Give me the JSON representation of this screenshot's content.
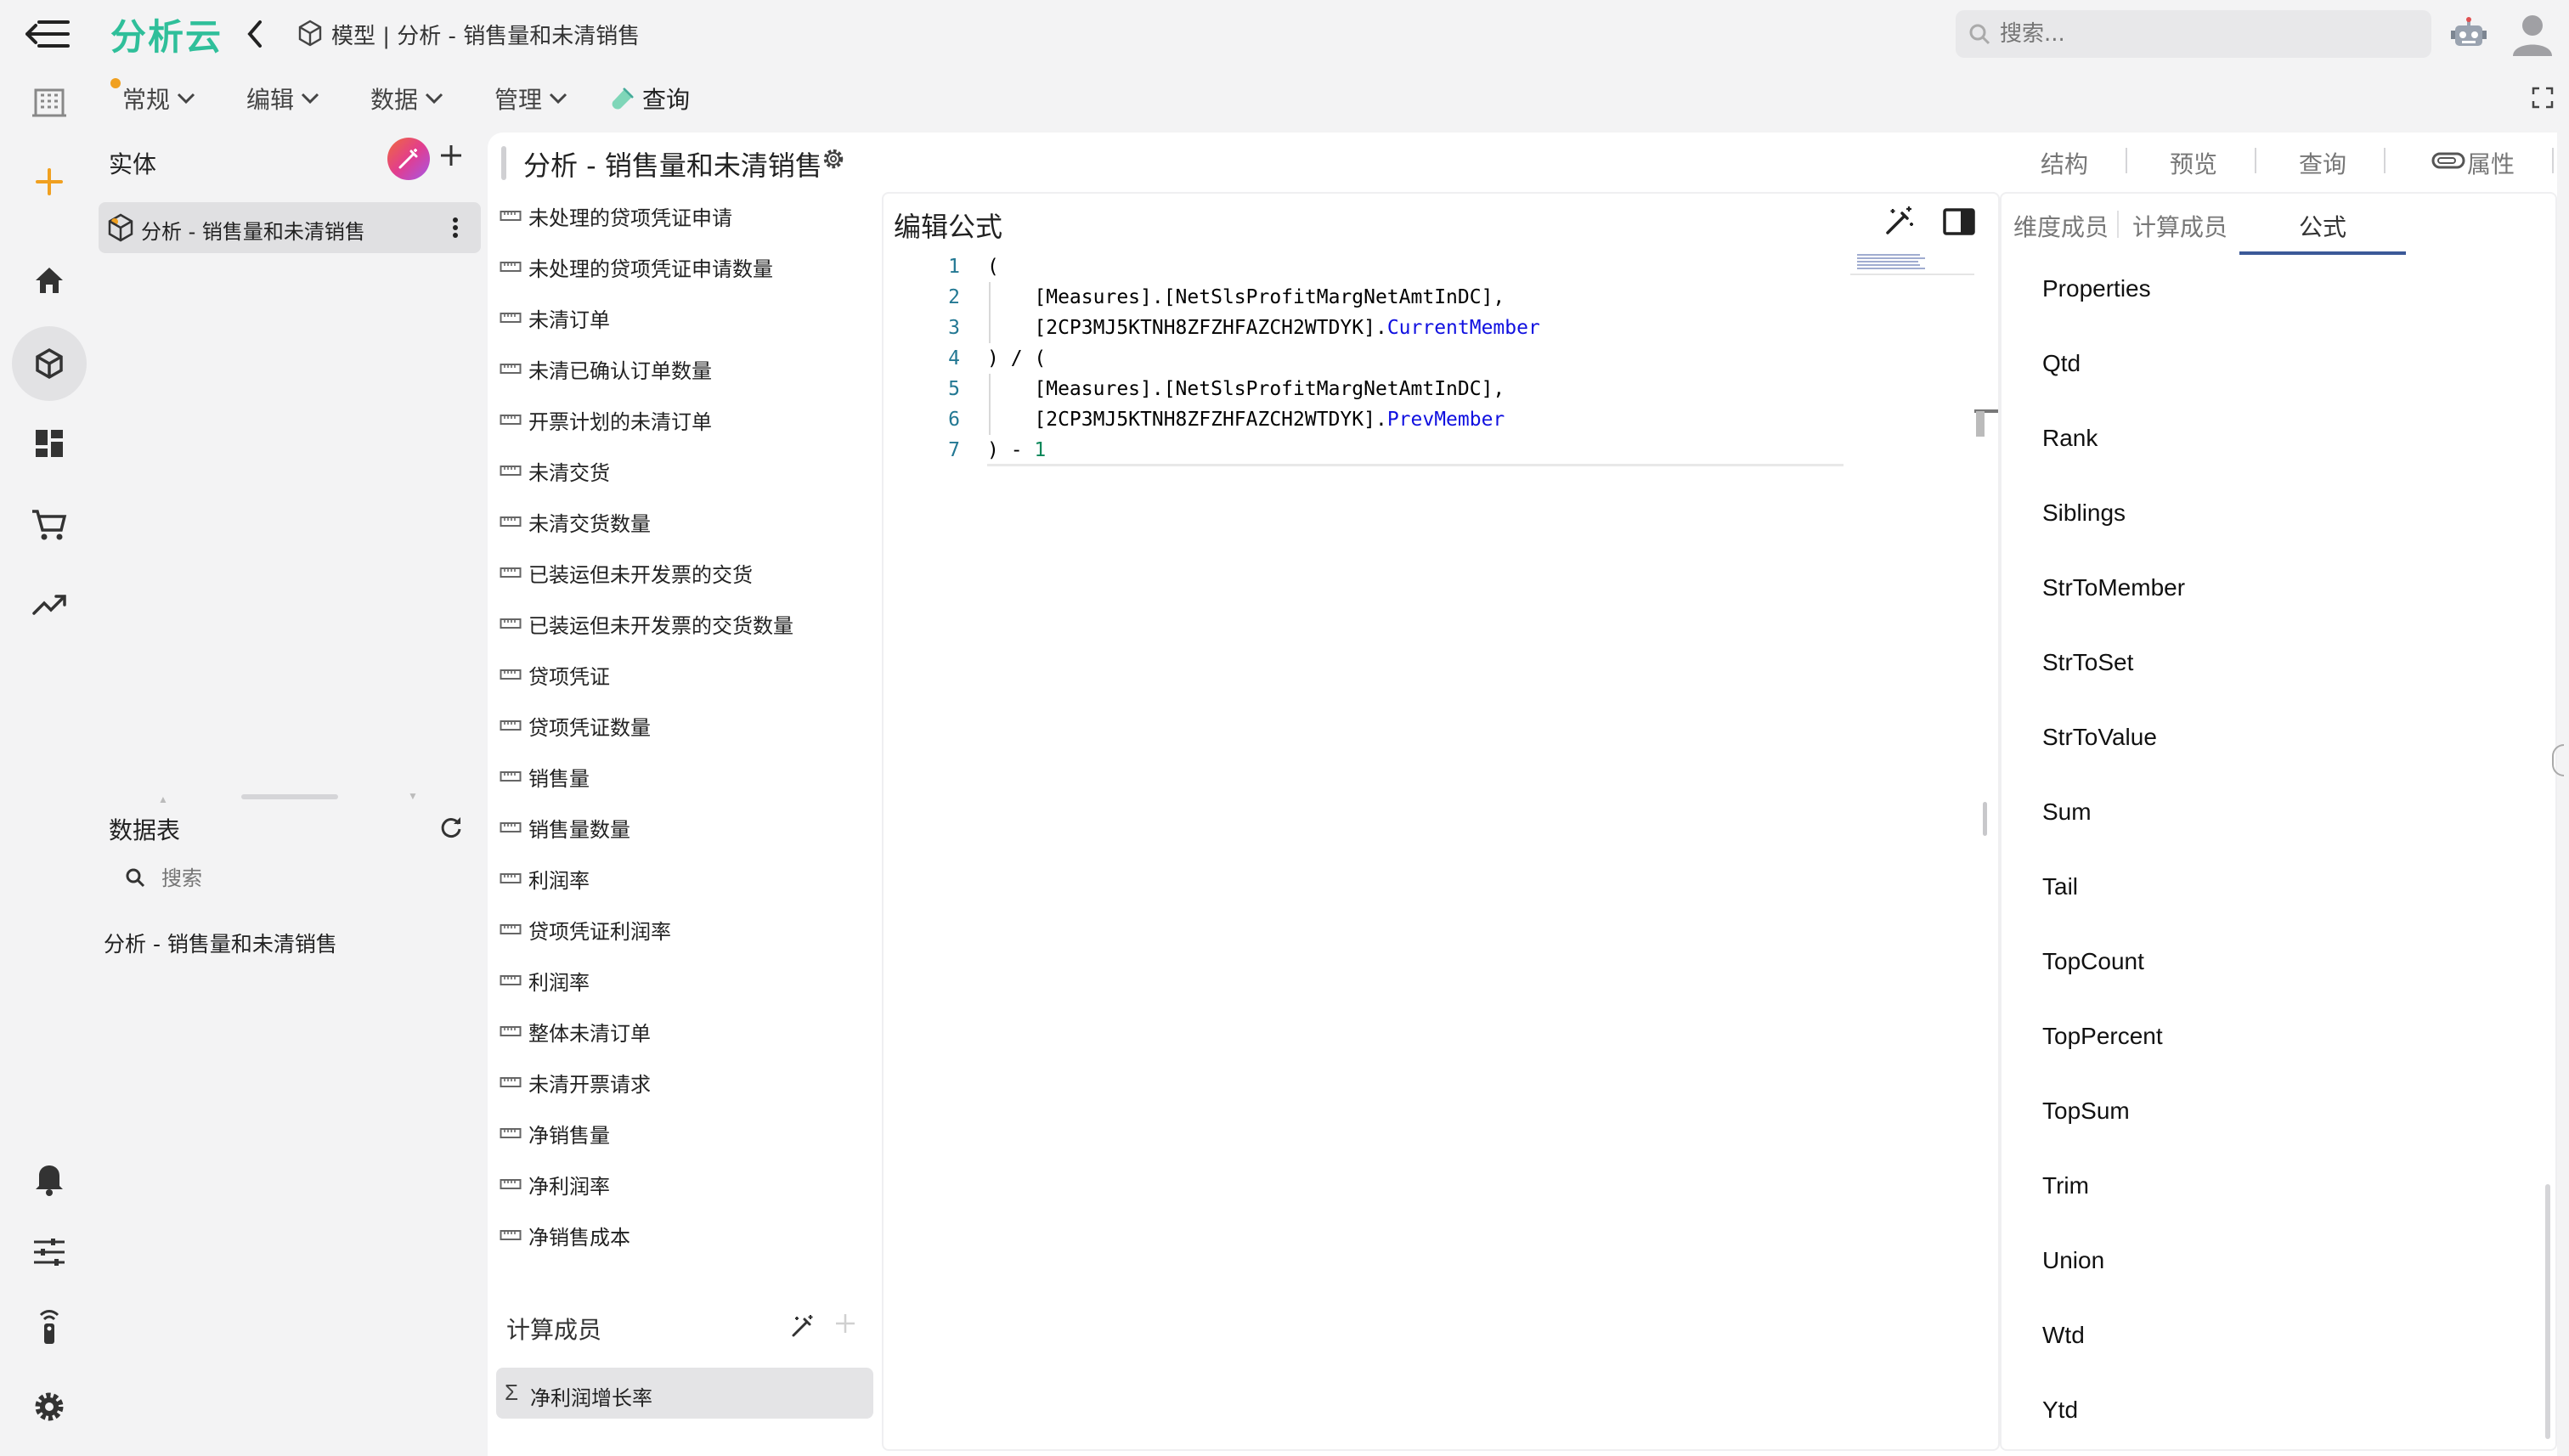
{
  "app": {
    "brand": "分析云",
    "breadcrumb": "模型 | 分析 - 销售量和未清销售"
  },
  "search": {
    "placeholder": "搜索..."
  },
  "menubar": {
    "items": [
      {
        "label": "常规"
      },
      {
        "label": "编辑"
      },
      {
        "label": "数据"
      },
      {
        "label": "管理"
      }
    ],
    "query_label": "查询"
  },
  "entity_panel": {
    "title": "实体",
    "items": [
      {
        "label": "分析 - 销售量和未清销售"
      }
    ]
  },
  "datasource_panel": {
    "title": "数据表",
    "search_placeholder": "搜索",
    "items": [
      {
        "label": "分析 - 销售量和未清销售"
      }
    ]
  },
  "model": {
    "title": "分析 - 销售量和未清销售",
    "tabs": [
      {
        "label": "结构"
      },
      {
        "label": "预览"
      },
      {
        "label": "查询"
      },
      {
        "label": "属性"
      }
    ]
  },
  "measures": [
    {
      "label": "未处理的贷项凭证申请"
    },
    {
      "label": "未处理的贷项凭证申请数量"
    },
    {
      "label": "未清订单"
    },
    {
      "label": "未清已确认订单数量"
    },
    {
      "label": "开票计划的未清订单"
    },
    {
      "label": "未清交货"
    },
    {
      "label": "未清交货数量"
    },
    {
      "label": "已装运但未开发票的交货"
    },
    {
      "label": "已装运但未开发票的交货数量"
    },
    {
      "label": "贷项凭证"
    },
    {
      "label": "贷项凭证数量"
    },
    {
      "label": "销售量"
    },
    {
      "label": "销售量数量"
    },
    {
      "label": "利润率"
    },
    {
      "label": "贷项凭证利润率"
    },
    {
      "label": "利润率"
    },
    {
      "label": "整体未清订单"
    },
    {
      "label": "未清开票请求"
    },
    {
      "label": "净销售量"
    },
    {
      "label": "净利润率"
    },
    {
      "label": "净销售成本"
    }
  ],
  "calc_members": {
    "title": "计算成员",
    "items": [
      {
        "symbol": "Σ",
        "label": "净利润增长率"
      }
    ]
  },
  "editor": {
    "title": "编辑公式",
    "lines": [
      {
        "num": "1",
        "parts": [
          {
            "t": "("
          }
        ]
      },
      {
        "num": "2",
        "parts": [
          {
            "t": "    [Measures].[NetSlsProfitMargNetAmtInDC],"
          }
        ]
      },
      {
        "num": "3",
        "parts": [
          {
            "t": "    [2CP3MJ5KTNH8ZFZHFAZCH2WTDYK]."
          },
          {
            "t": "CurrentMember",
            "c": "kw"
          }
        ]
      },
      {
        "num": "4",
        "parts": [
          {
            "t": ") / ("
          }
        ]
      },
      {
        "num": "5",
        "parts": [
          {
            "t": "    [Measures].[NetSlsProfitMargNetAmtInDC],"
          }
        ]
      },
      {
        "num": "6",
        "parts": [
          {
            "t": "    [2CP3MJ5KTNH8ZFZHFAZCH2WTDYK]."
          },
          {
            "t": "PrevMember",
            "c": "kw"
          }
        ]
      },
      {
        "num": "7",
        "parts": [
          {
            "t": ") - "
          },
          {
            "t": "1",
            "c": "num"
          }
        ]
      }
    ]
  },
  "right_panel": {
    "tabs": [
      {
        "label": "维度成员"
      },
      {
        "label": "计算成员"
      },
      {
        "label": "公式",
        "active": true
      }
    ],
    "functions": [
      "Properties",
      "Qtd",
      "Rank",
      "Siblings",
      "StrToMember",
      "StrToSet",
      "StrToValue",
      "Sum",
      "Tail",
      "TopCount",
      "TopPercent",
      "TopSum",
      "Trim",
      "Union",
      "Wtd",
      "Ytd"
    ]
  }
}
